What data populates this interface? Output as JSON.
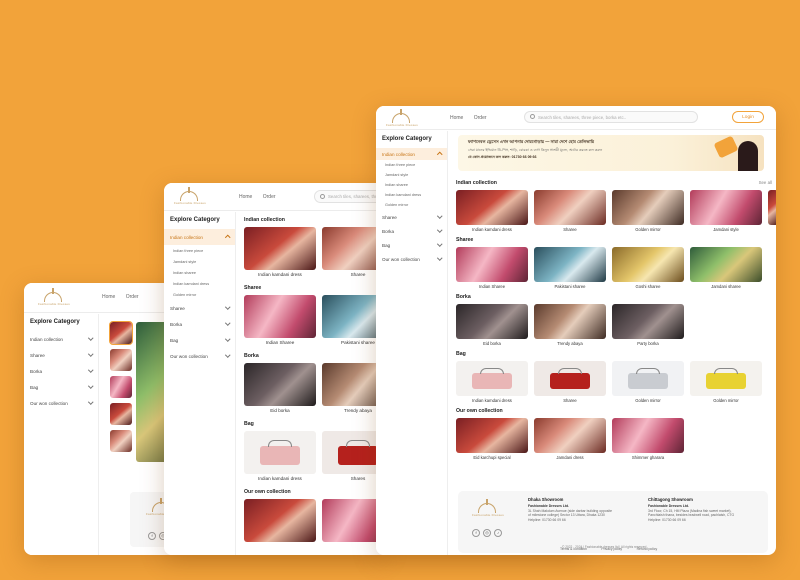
{
  "brand": {
    "name": "Fashionable Dresses",
    "accent": "#F2A33A"
  },
  "nav": {
    "home": "Home",
    "order": "Order"
  },
  "search": {
    "placeholder": "Search tiles, sharees, three piece, borka etc..",
    "short_placeholder": "Search tiles, sharees, three"
  },
  "login_label": "Login",
  "sidebar": {
    "title": "Explore Category",
    "categories": [
      {
        "label": "Indian collection"
      },
      {
        "label": "Sharee"
      },
      {
        "label": "Borka"
      },
      {
        "label": "Bag"
      },
      {
        "label": "Our won collection"
      }
    ],
    "subcategories": [
      "Indian three piece",
      "Jamdani style",
      "Indian sharee",
      "Indian kamdani dress",
      "Golden mirror"
    ]
  },
  "banner": {
    "line1": "ফ্যাশনেবল ড্রেসেস এখন আপনার দোরগোড়ায় — সারা দেশে হোম ডেলিভারি",
    "line2": "সেরা মানের ইন্ডিয়ান থ্রি-পিস, শাড়ি, বোরকা ও ব্যাগ কিনুন সাশ্রয়ী মূল্যে, অর্ডার করতে কল করুন",
    "line3": "যে কোন প্রয়োজনে কল করুন: 01730 66 09 66"
  },
  "sections": {
    "indian": {
      "title": "Indian collection",
      "see_all": "See all",
      "items": [
        "Indian kamdani dress",
        "Sharee",
        "Golden mirror",
        "Jamdani style"
      ]
    },
    "sharee": {
      "title": "Sharee",
      "items": [
        "Indian Sharee",
        "Pakistani sharee",
        "Goshi sharee",
        "Jamdani sharee"
      ]
    },
    "borka": {
      "title": "Borka",
      "items": [
        "Eid borka",
        "Trendy abaya",
        "Party borka"
      ]
    },
    "bag": {
      "title": "Bag",
      "items": [
        "Indian kamdani dress",
        "Sharee",
        "Golden mirror",
        "Golden mirror"
      ],
      "mid_items": [
        "Indian kamdani dress",
        "Shares"
      ]
    },
    "own": {
      "title": "Our own collection",
      "items": [
        "Eid karchupi special",
        "Jamdani dress",
        "Shimmer gharara"
      ]
    }
  },
  "footer": {
    "dhaka": {
      "title": "Dhaka Showroom",
      "name": "Fashionable Dresses Ltd.",
      "addr1": "3L Shah Makdum Avenue (side darbar building opposite",
      "addr2": "of milestone college) Sector 13 Uttara, Dhaka 1230",
      "phone": "Helpline: 01730 66 09 66"
    },
    "ctg": {
      "title": "Chittagong Showroom",
      "name": "Fashionable Dresses Ltd.",
      "addr1": "3rd Floor, Ch 15, HM Plaza (Madina fish sweet market),",
      "addr2": "Panchlaish thana, besides bradwell road, pachlaish, CTG",
      "phone": "Helpline: 01730 66 09 66"
    },
    "links": [
      "Terms & condition",
      "Privacy policy",
      "Refund policy"
    ],
    "copyright": "© 2022 - 2024 | Fashionable dresses ltd | All rights reserved"
  },
  "social_icons": [
    "facebook-icon",
    "instagram-icon",
    "tiktok-icon"
  ]
}
